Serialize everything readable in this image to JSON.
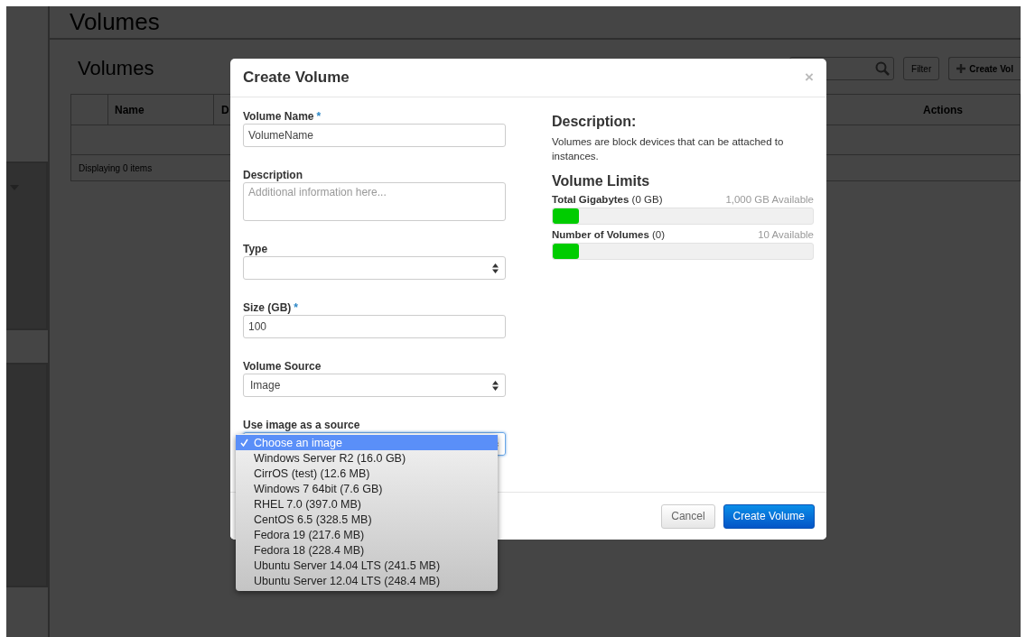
{
  "page": {
    "top_heading": "Volumes",
    "section_title": "Volumes",
    "filter_button": "Filter",
    "create_button": "Create Vol",
    "table": {
      "columns": [
        "Name",
        "D",
        "Actions"
      ],
      "footer": "Displaying 0 items"
    }
  },
  "modal": {
    "title": "Create Volume",
    "close": "×",
    "fields": [
      {
        "kind": "text",
        "label": "Volume Name",
        "required_mark": "*",
        "value": "VolumeName"
      },
      {
        "kind": "textarea",
        "label": "Description",
        "placeholder": "Additional information here..."
      },
      {
        "kind": "select",
        "label": "Type"
      },
      {
        "kind": "text",
        "label": "Size (GB)",
        "required_mark": "*",
        "value": "100"
      },
      {
        "kind": "select",
        "label": "Volume Source",
        "value": "Image"
      },
      {
        "kind": "select",
        "label": "Use image as a source",
        "open": true
      }
    ],
    "dropdown_options": [
      {
        "label": "Choose an image",
        "selected": true
      },
      {
        "label": "Windows Server R2 (16.0 GB)",
        "selected": false
      },
      {
        "label": "CirrOS (test) (12.6 MB)",
        "selected": false
      },
      {
        "label": "Windows 7 64bit (7.6 GB)",
        "selected": false
      },
      {
        "label": "RHEL 7.0 (397.0 MB)",
        "selected": false
      },
      {
        "label": "CentOS 6.5 (328.5 MB)",
        "selected": false
      },
      {
        "label": "Fedora 19 (217.6 MB)",
        "selected": false
      },
      {
        "label": "Fedora 18 (228.4 MB)",
        "selected": false
      },
      {
        "label": "Ubuntu Server 14.04 LTS (241.5 MB)",
        "selected": false
      },
      {
        "label": "Ubuntu Server 12.04 LTS (248.4 MB)",
        "selected": false
      }
    ],
    "info": {
      "heading": "Description:",
      "text": "Volumes are block devices that can be attached to instances.",
      "limits_heading": "Volume Limits",
      "limits": [
        {
          "label": "Total Gigabytes",
          "amount": "(0 GB)",
          "available": "1,000 GB Available",
          "level": 0.1
        },
        {
          "label": "Number of Volumes",
          "amount": "(0)",
          "available": "10 Available",
          "level": 0.1
        }
      ]
    },
    "buttons": [
      {
        "kind": "secondary",
        "label": "Cancel"
      },
      {
        "kind": "primary",
        "label": "Create Volume"
      }
    ]
  }
}
